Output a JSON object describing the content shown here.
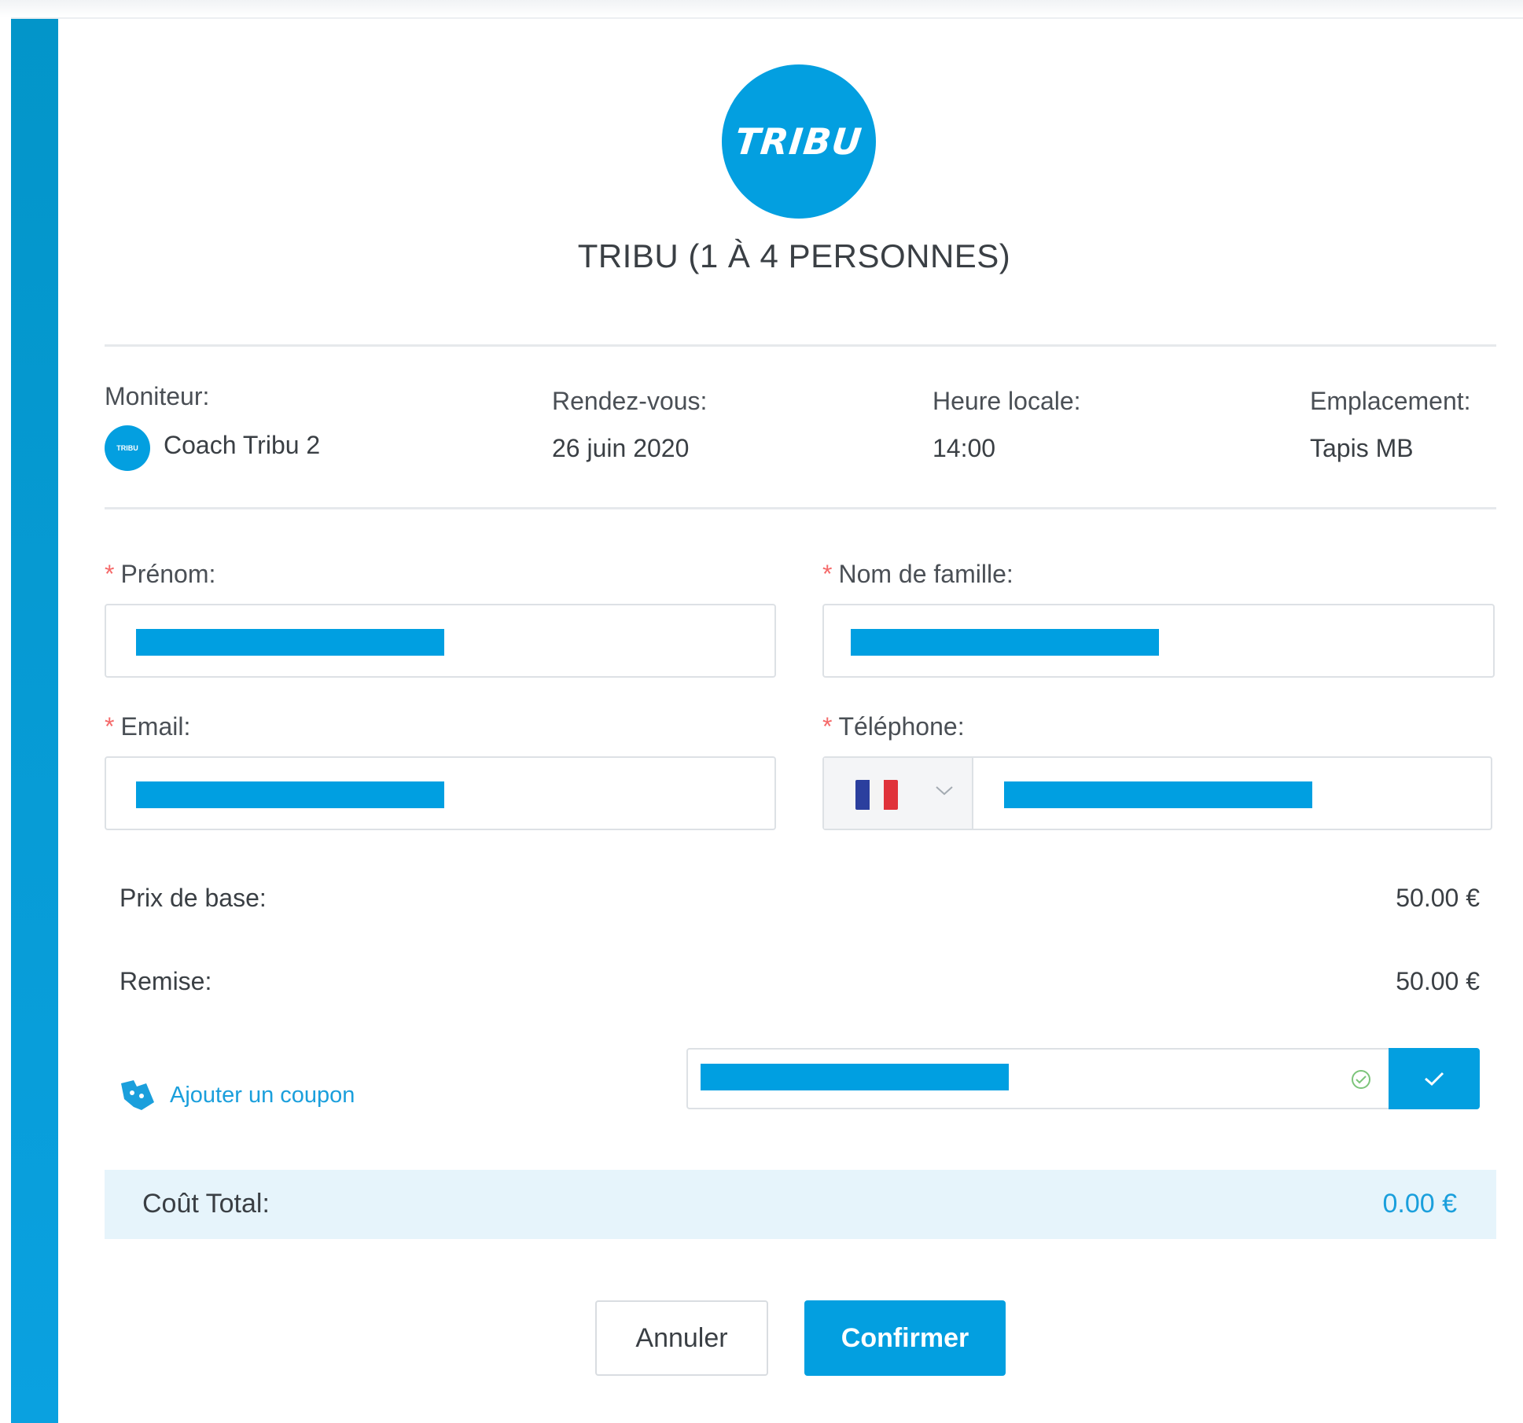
{
  "logo": {
    "text": "TRIBU",
    "color": "#039fe0"
  },
  "service": {
    "title": "TRIBU (1 À 4 PERSONNES)"
  },
  "info": {
    "moniteur_label": "Moniteur:",
    "moniteur_value": "Coach Tribu 2",
    "rdv_label": "Rendez-vous:",
    "rdv_value": "26 juin 2020",
    "heure_label": "Heure locale:",
    "heure_value": "14:00",
    "emplacement_label": "Emplacement:",
    "emplacement_value": "Tapis MB"
  },
  "form": {
    "required_mark": "*",
    "prenom_label": "Prénom:",
    "nom_label": "Nom de famille:",
    "email_label": "Email:",
    "telephone_label": "Téléphone:"
  },
  "pricing": {
    "base_label": "Prix de base:",
    "base_value": "50.00 €",
    "remise_label": "Remise:",
    "remise_value": "50.00 €",
    "coupon_link": "Ajouter un coupon",
    "total_label": "Coût Total:",
    "total_value": "0.00 €"
  },
  "actions": {
    "cancel_label": "Annuler",
    "confirm_label": "Confirmer"
  },
  "colors": {
    "accent": "#039fe0",
    "required": "#f56a6a",
    "total_bg": "#e6f4fb"
  }
}
